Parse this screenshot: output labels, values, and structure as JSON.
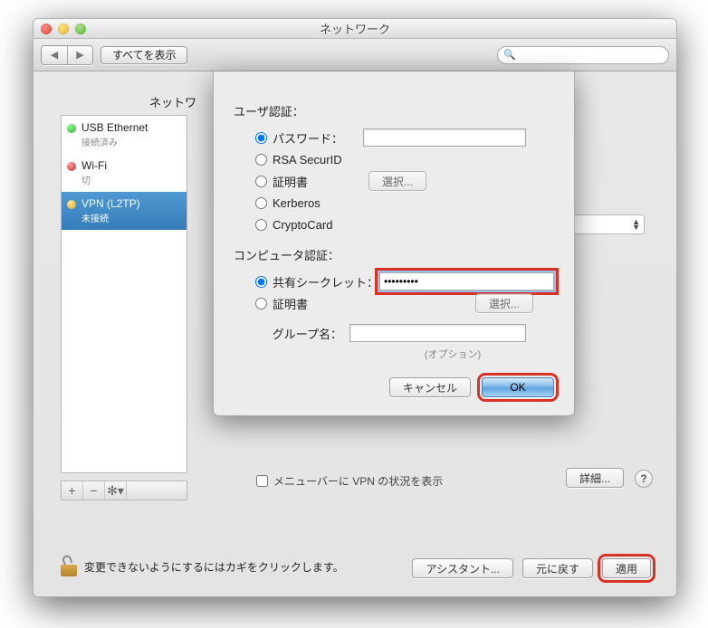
{
  "window": {
    "title": "ネットワーク",
    "show_all": "すべてを表示",
    "location_label": "ネットワ"
  },
  "sidebar": {
    "items": [
      {
        "name": "USB Ethernet",
        "sub": "接続済み"
      },
      {
        "name": "Wi-Fi",
        "sub": "切"
      },
      {
        "name": "VPN (L2TP)",
        "sub": "未接続"
      }
    ],
    "add": "+",
    "remove": "−",
    "gear": "✽"
  },
  "panel": {
    "menubar_checkbox": "メニューバーに VPN の状況を表示",
    "details": "詳細...",
    "help": "?"
  },
  "lock": {
    "text": "変更できないようにするにはカギをクリックします。"
  },
  "bottom": {
    "assistant": "アシスタント...",
    "revert": "元に戻す",
    "apply": "適用"
  },
  "sheet": {
    "user_auth": "ユーザ認証：",
    "radios_user": {
      "password": "パスワード：",
      "rsa": "RSA SecurID",
      "cert": "証明書",
      "kerberos": "Kerberos",
      "cryptocard": "CryptoCard"
    },
    "select_btn": "選択...",
    "machine_auth": "コンピュータ認証：",
    "radios_machine": {
      "shared_secret": "共有シークレット：",
      "cert": "証明書"
    },
    "shared_secret_value": "•••••••••",
    "group_label": "グループ名：",
    "group_value": "",
    "option_note": "(オプション)",
    "cancel": "キャンセル",
    "ok": "OK"
  }
}
